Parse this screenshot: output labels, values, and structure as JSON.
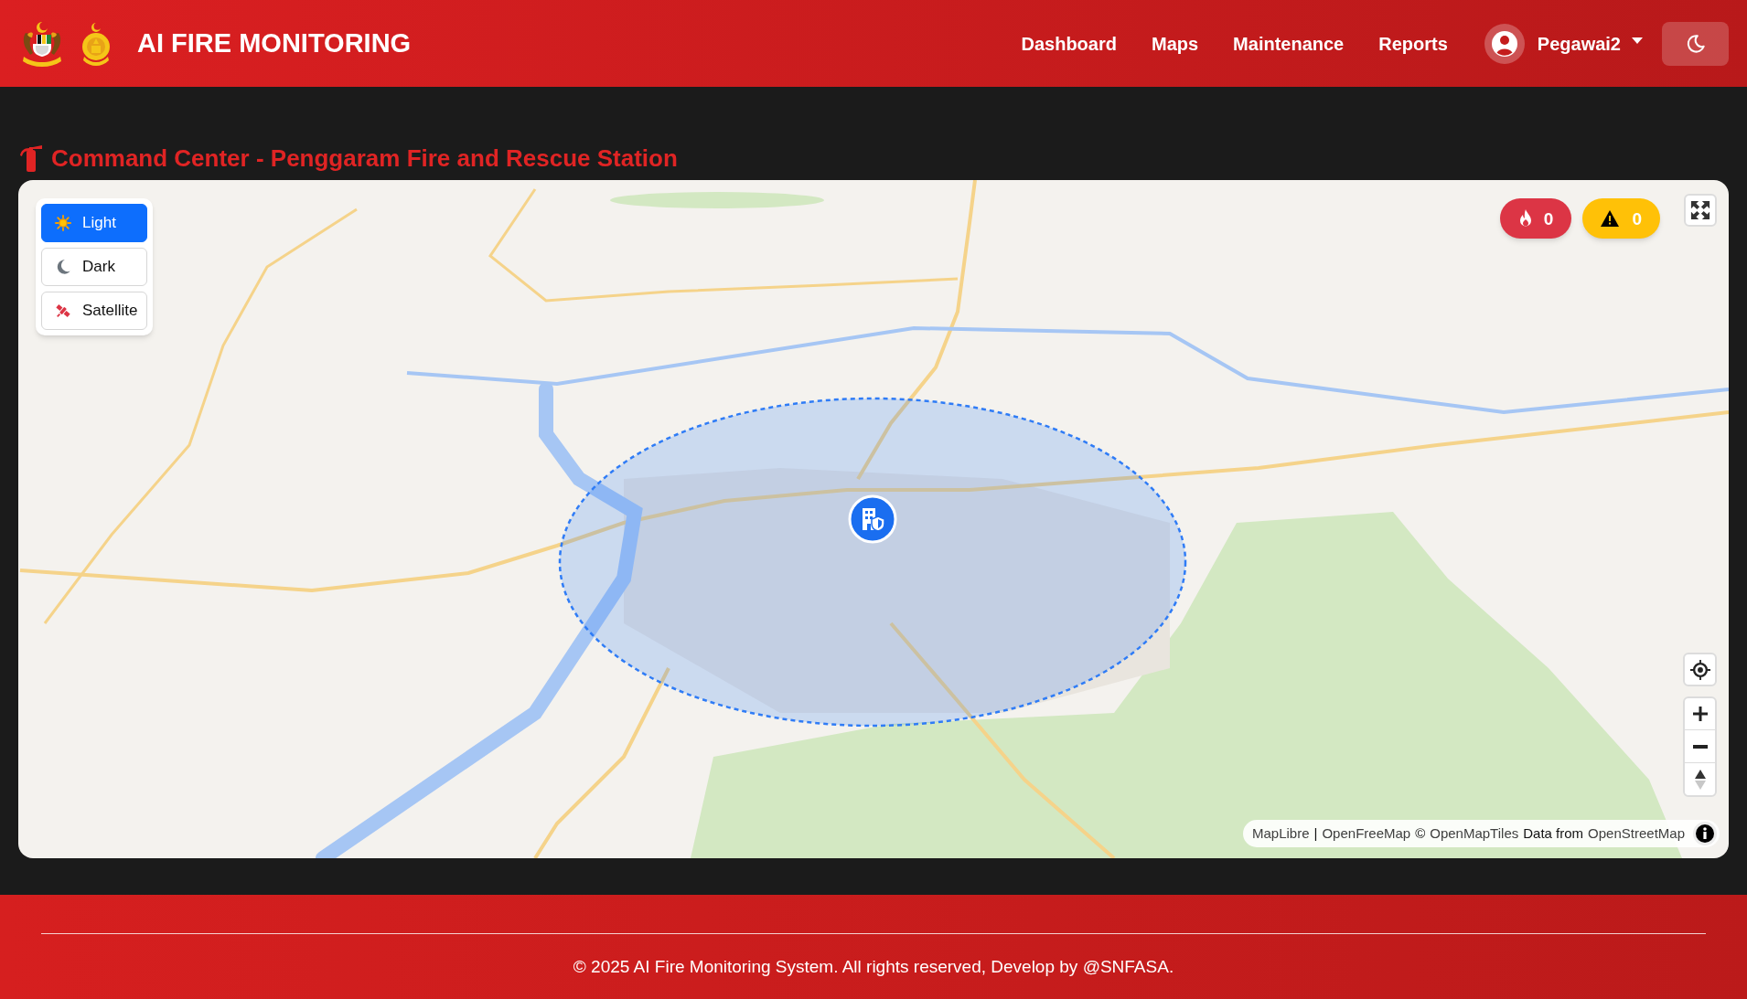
{
  "header": {
    "title": "AI FIRE MONITORING",
    "nav": [
      "Dashboard",
      "Maps",
      "Maintenance",
      "Reports"
    ],
    "user": {
      "name": "Pegawai2"
    }
  },
  "page_title": "Command Center - Penggaram Fire and Rescue Station",
  "map": {
    "styles": [
      {
        "label": "Light",
        "selected": true
      },
      {
        "label": "Dark",
        "selected": false
      },
      {
        "label": "Satellite",
        "selected": false
      }
    ],
    "badges": [
      {
        "kind": "fire",
        "count": "0"
      },
      {
        "kind": "warning",
        "count": "0"
      }
    ],
    "attribution": [
      {
        "kind": "link",
        "text": "MapLibre"
      },
      {
        "kind": "text",
        "text": "|"
      },
      {
        "kind": "link",
        "text": "OpenFreeMap"
      },
      {
        "kind": "text",
        "text": "©"
      },
      {
        "kind": "link",
        "text": "OpenMapTiles"
      },
      {
        "kind": "text",
        "text": "Data from"
      },
      {
        "kind": "link",
        "text": "OpenStreetMap"
      }
    ]
  },
  "footer": {
    "text": "© 2025 AI Fire Monitoring System. All rights reserved, Develop by @SNFASA."
  }
}
